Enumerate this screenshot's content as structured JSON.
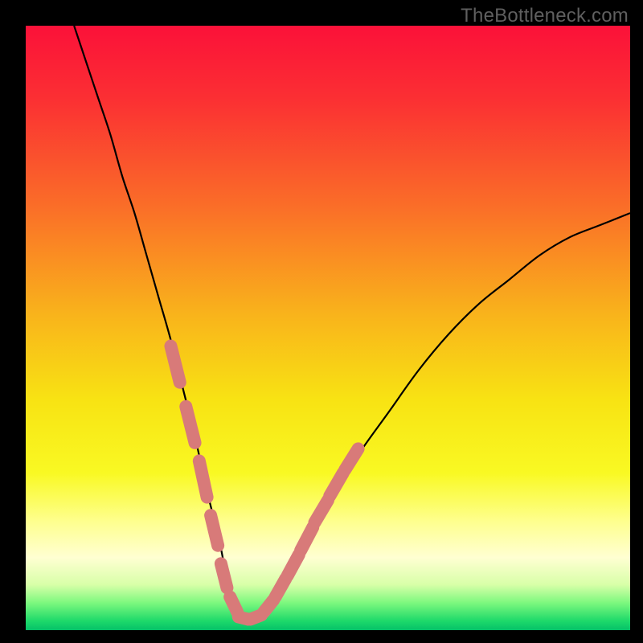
{
  "watermark": "TheBottleneck.com",
  "colors": {
    "frame": "#000000",
    "curve": "#000000",
    "marker": "#d87a79",
    "gradient_stops": [
      {
        "offset": 0.0,
        "color": "#fb1139"
      },
      {
        "offset": 0.12,
        "color": "#fb2f33"
      },
      {
        "offset": 0.3,
        "color": "#fa6e28"
      },
      {
        "offset": 0.48,
        "color": "#f9b41b"
      },
      {
        "offset": 0.62,
        "color": "#f8e313"
      },
      {
        "offset": 0.74,
        "color": "#f9f923"
      },
      {
        "offset": 0.82,
        "color": "#feff8e"
      },
      {
        "offset": 0.88,
        "color": "#ffffd2"
      },
      {
        "offset": 0.925,
        "color": "#d8ffa8"
      },
      {
        "offset": 0.955,
        "color": "#7cf87e"
      },
      {
        "offset": 0.985,
        "color": "#1dd96a"
      },
      {
        "offset": 1.0,
        "color": "#05c168"
      }
    ]
  },
  "chart_data": {
    "type": "line",
    "title": "",
    "xlabel": "",
    "ylabel": "",
    "xlim": [
      0,
      100
    ],
    "ylim": [
      0,
      100
    ],
    "series": [
      {
        "name": "bottleneck-curve",
        "x": [
          8,
          10,
          12,
          14,
          16,
          18,
          20,
          22,
          24,
          26,
          28,
          30,
          31,
          32,
          33,
          34,
          35,
          36,
          38,
          40,
          43,
          46,
          50,
          55,
          60,
          65,
          70,
          75,
          80,
          85,
          90,
          95,
          100
        ],
        "y": [
          100,
          94,
          88,
          82,
          75,
          69,
          62,
          55,
          48,
          40,
          32,
          23,
          19,
          15,
          10,
          6,
          3,
          2,
          2,
          4,
          8,
          14,
          21,
          29,
          36,
          43,
          49,
          54,
          58,
          62,
          65,
          67,
          69
        ]
      }
    ],
    "markers": {
      "name": "highlight-segments",
      "segments": [
        {
          "x0": 24.0,
          "y0": 47,
          "x1": 25.5,
          "y1": 41
        },
        {
          "x0": 26.5,
          "y0": 37,
          "x1": 28.0,
          "y1": 31
        },
        {
          "x0": 28.7,
          "y0": 28,
          "x1": 30.0,
          "y1": 22
        },
        {
          "x0": 30.6,
          "y0": 19,
          "x1": 31.8,
          "y1": 14
        },
        {
          "x0": 32.3,
          "y0": 11,
          "x1": 33.3,
          "y1": 7
        },
        {
          "x0": 33.8,
          "y0": 5.5,
          "x1": 35.0,
          "y1": 3.0
        },
        {
          "x0": 35.2,
          "y0": 2.2,
          "x1": 36.8,
          "y1": 1.8
        },
        {
          "x0": 37.2,
          "y0": 1.8,
          "x1": 39.0,
          "y1": 2.5
        },
        {
          "x0": 39.4,
          "y0": 3.0,
          "x1": 41.0,
          "y1": 5.0
        },
        {
          "x0": 41.3,
          "y0": 5.5,
          "x1": 43.0,
          "y1": 8.5
        },
        {
          "x0": 43.3,
          "y0": 9.0,
          "x1": 45.2,
          "y1": 12.5
        },
        {
          "x0": 45.5,
          "y0": 13.2,
          "x1": 47.5,
          "y1": 17.0
        },
        {
          "x0": 47.8,
          "y0": 17.8,
          "x1": 50.0,
          "y1": 21.5
        },
        {
          "x0": 50.3,
          "y0": 22.2,
          "x1": 52.5,
          "y1": 26.0
        },
        {
          "x0": 52.8,
          "y0": 26.5,
          "x1": 55.0,
          "y1": 30.0
        }
      ]
    }
  }
}
